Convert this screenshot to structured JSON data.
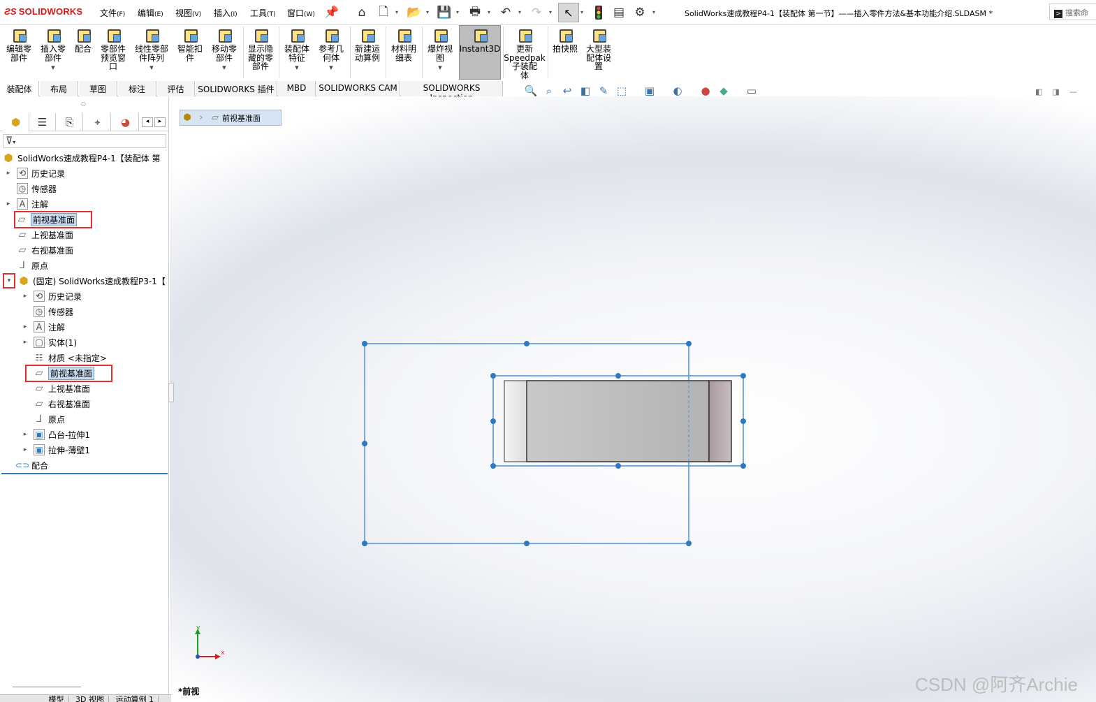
{
  "app": {
    "logo": "SOLIDWORKS",
    "document_title": "SolidWorks速成教程P4-1【装配体  第一节】——插入零件方法&基本功能介绍.SLDASM *",
    "search_placeholder": "搜索命"
  },
  "menu": [
    {
      "label": "文件",
      "key": "(F)"
    },
    {
      "label": "编辑",
      "key": "(E)"
    },
    {
      "label": "视图",
      "key": "(V)"
    },
    {
      "label": "插入",
      "key": "(I)"
    },
    {
      "label": "工具",
      "key": "(T)"
    },
    {
      "label": "窗口",
      "key": "(W)"
    }
  ],
  "ribbon": [
    {
      "label": "编辑零\n部件"
    },
    {
      "label": "插入零\n部件"
    },
    {
      "label": "配合"
    },
    {
      "label": "零部件\n预览窗\n口"
    },
    {
      "label": "线性零部\n件阵列"
    },
    {
      "label": "智能扣\n件"
    },
    {
      "label": "移动零\n部件"
    },
    {
      "label": "显示隐\n藏的零\n部件"
    },
    {
      "label": "装配体\n特征"
    },
    {
      "label": "参考几\n何体"
    },
    {
      "label": "新建运\n动算例"
    },
    {
      "label": "材料明\n细表"
    },
    {
      "label": "爆炸视\n图"
    },
    {
      "label": "Instant3D"
    },
    {
      "label": "更新\nSpeedpak\n子装配\n体"
    },
    {
      "label": "拍快照"
    },
    {
      "label": "大型装\n配体设\n置"
    }
  ],
  "tabs": [
    "装配体",
    "布局",
    "草图",
    "标注",
    "评估",
    "SOLIDWORKS 插件",
    "MBD",
    "SOLIDWORKS CAM",
    "SOLIDWORKS Inspection"
  ],
  "tree": [
    {
      "label": "SolidWorks速成教程P4-1【装配体  第",
      "icon": "assembly-icon",
      "indent": 0,
      "arrow": ""
    },
    {
      "label": "历史记录",
      "icon": "history-icon",
      "indent": 1,
      "arrow": "▸"
    },
    {
      "label": "传感器",
      "icon": "sensor-icon",
      "indent": 1,
      "arrow": ""
    },
    {
      "label": "注解",
      "icon": "annotation-icon",
      "indent": 1,
      "arrow": "▸"
    },
    {
      "label": "前视基准面",
      "icon": "plane-icon",
      "indent": 1,
      "arrow": "",
      "selected": true
    },
    {
      "label": "上视基准面",
      "icon": "plane-icon",
      "indent": 1,
      "arrow": ""
    },
    {
      "label": "右视基准面",
      "icon": "plane-icon",
      "indent": 1,
      "arrow": ""
    },
    {
      "label": "原点",
      "icon": "origin-icon",
      "indent": 1,
      "arrow": ""
    },
    {
      "label": "(固定) SolidWorks速成教程P3-1【",
      "icon": "part-icon",
      "indent": 1,
      "arrow": "▾"
    },
    {
      "label": "历史记录",
      "icon": "history-icon",
      "indent": 2,
      "arrow": "▸"
    },
    {
      "label": "传感器",
      "icon": "sensor-icon",
      "indent": 2,
      "arrow": ""
    },
    {
      "label": "注解",
      "icon": "annotation-icon",
      "indent": 2,
      "arrow": "▸"
    },
    {
      "label": "实体(1)",
      "icon": "solid-body-icon",
      "indent": 2,
      "arrow": "▸"
    },
    {
      "label": "材质 <未指定>",
      "icon": "material-icon",
      "indent": 2,
      "arrow": ""
    },
    {
      "label": "前视基准面",
      "icon": "plane-icon",
      "indent": 2,
      "arrow": "",
      "selected": true
    },
    {
      "label": "上视基准面",
      "icon": "plane-icon",
      "indent": 2,
      "arrow": ""
    },
    {
      "label": "右视基准面",
      "icon": "plane-icon",
      "indent": 2,
      "arrow": ""
    },
    {
      "label": "原点",
      "icon": "origin-icon",
      "indent": 2,
      "arrow": ""
    },
    {
      "label": "凸台-拉伸1",
      "icon": "extrude-icon",
      "indent": 2,
      "arrow": "▸"
    },
    {
      "label": "拉伸-薄壁1",
      "icon": "extrude-icon",
      "indent": 2,
      "arrow": "▸"
    },
    {
      "label": "配合",
      "icon": "mates-icon",
      "indent": 1,
      "arrow": ""
    }
  ],
  "breadcrumb": {
    "label": "前视基准面"
  },
  "viewport": {
    "view_name": "*前视",
    "triad": {
      "x_label": "x",
      "y_label": "y"
    }
  },
  "bottom_tabs": [
    "模型",
    "3D 视图",
    "运动算例 1"
  ],
  "watermark": "CSDN @阿齐Archie",
  "colors": {
    "accent": "#2f78c2",
    "highlight": "#e03030",
    "selection": "#c9daef"
  }
}
